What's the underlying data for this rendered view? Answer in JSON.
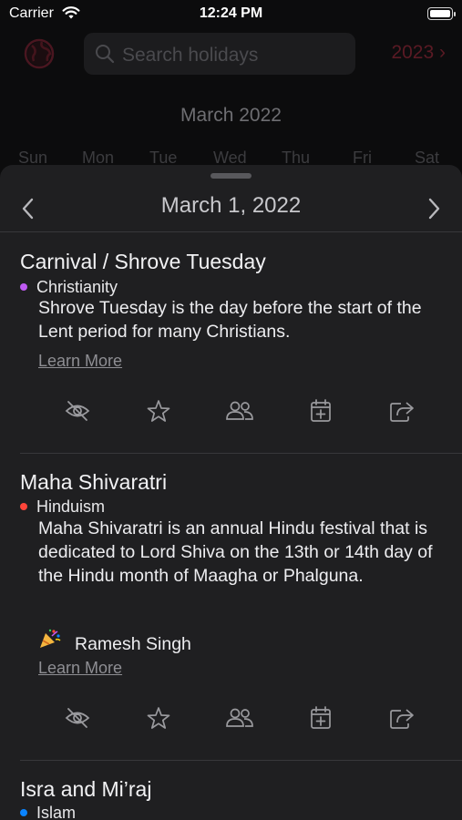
{
  "status_bar": {
    "carrier": "Carrier",
    "time": "12:24 PM"
  },
  "toolbar": {
    "search_placeholder": "Search holidays",
    "year_label": "2023",
    "accent_color": "#5a1a24"
  },
  "calendar": {
    "month_title": "March 2022",
    "weekdays": [
      "Sun",
      "Mon",
      "Tue",
      "Wed",
      "Thu",
      "Fri",
      "Sat"
    ]
  },
  "sheet": {
    "date_title": "March 1, 2022",
    "entries": [
      {
        "title": "Carnival / Shrove Tuesday",
        "religion": "Christianity",
        "religion_color": "#bf5af2",
        "description": "Shrove Tuesday is the day before the start of the Lent period for many Christians.",
        "learn_more": "Learn More"
      },
      {
        "title": "Maha Shivaratri",
        "religion": "Hinduism",
        "religion_color": "#ff453a",
        "description": "Maha Shivaratri is an annual Hindu festival that is dedicated to Lord Shiva on the 13th or 14th day of the Hindu month of Maagha or Phalguna.",
        "person": "Ramesh Singh",
        "person_icon": "party-popper-icon",
        "learn_more": "Learn More"
      },
      {
        "title": "Isra and Mi’raj",
        "religion": "Islam",
        "religion_color": "#0a84ff"
      }
    ],
    "action_icons": [
      "hide-icon",
      "star-icon",
      "people-icon",
      "calendar-add-icon",
      "share-icon"
    ]
  }
}
